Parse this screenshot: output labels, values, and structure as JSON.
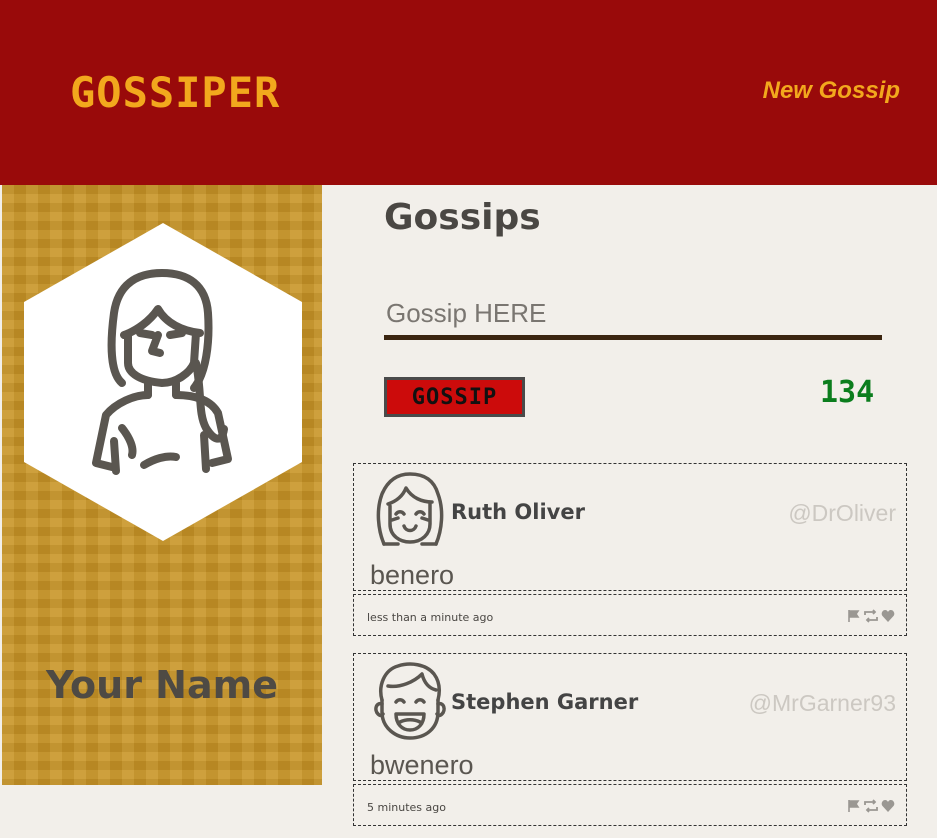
{
  "header": {
    "brand": "GOSSIPER",
    "new_gossip_label": "New Gossip"
  },
  "colors": {
    "header_bg": "#990a0a",
    "brand": "#f2a81d",
    "sidebar_bg": "#c89526",
    "button_bg": "#cc0b0b",
    "counter": "#0b7d1d",
    "page_bg": "#f2efea"
  },
  "sidebar": {
    "avatar_icon": "woman-avatar-icon",
    "name": "Your Name"
  },
  "main": {
    "title": "Gossips",
    "input": {
      "placeholder": "Gossip HERE",
      "value": ""
    },
    "button_label": "GOSSIP",
    "char_count": "134"
  },
  "gossips": [
    {
      "author": "Ruth Oliver",
      "handle": "@DrOliver",
      "content": "benero",
      "time": "less than a minute ago",
      "avatar_icon": "girl-avatar-icon"
    },
    {
      "author": "Stephen Garner",
      "handle": "@MrGarner93",
      "content": "bwenero",
      "time": "5 minutes ago",
      "avatar_icon": "boy-avatar-icon"
    }
  ]
}
